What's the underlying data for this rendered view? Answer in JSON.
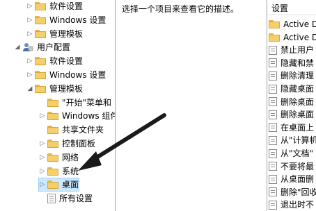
{
  "tree": {
    "items": [
      {
        "label": "软件设置",
        "level": 2,
        "type": "folder",
        "expand": "▷"
      },
      {
        "label": "Windows 设置",
        "level": 2,
        "type": "folder",
        "expand": "▷"
      },
      {
        "label": "管理模板",
        "level": 2,
        "type": "folder",
        "expand": "▷"
      },
      {
        "label": "用户配置",
        "level": 1,
        "type": "user",
        "expand": "◢"
      },
      {
        "label": "软件设置",
        "level": 2,
        "type": "folder",
        "expand": "▷"
      },
      {
        "label": "Windows 设置",
        "level": 2,
        "type": "folder",
        "expand": "▷"
      },
      {
        "label": "管理模板",
        "level": 2,
        "type": "folder",
        "expand": "◢"
      },
      {
        "label": "\"开始\"菜单和",
        "level": 3,
        "type": "folder",
        "expand": ""
      },
      {
        "label": "Windows 组件",
        "level": 3,
        "type": "folder",
        "expand": "▷"
      },
      {
        "label": "共享文件夹",
        "level": 3,
        "type": "folder",
        "expand": ""
      },
      {
        "label": "控制面板",
        "level": 3,
        "type": "folder",
        "expand": "▷"
      },
      {
        "label": "网络",
        "level": 3,
        "type": "folder",
        "expand": "▷"
      },
      {
        "label": "系统",
        "level": 3,
        "type": "folder",
        "expand": "▷"
      },
      {
        "label": "桌面",
        "level": 3,
        "type": "folder",
        "expand": "▷",
        "selected": true
      },
      {
        "label": "所有设置",
        "level": 3,
        "type": "doc",
        "expand": ""
      }
    ]
  },
  "description": {
    "text": "选择一个项目来查看它的描述。"
  },
  "settings_list": {
    "header": "设置",
    "items": [
      {
        "label": "Active De",
        "type": "folder"
      },
      {
        "label": "Active Di",
        "type": "folder"
      },
      {
        "label": "禁止用户",
        "type": "policy"
      },
      {
        "label": "隐藏和禁",
        "type": "policy"
      },
      {
        "label": "删除清理",
        "type": "policy"
      },
      {
        "label": "隐藏桌面",
        "type": "policy"
      },
      {
        "label": "删除桌面",
        "type": "policy"
      },
      {
        "label": "删除桌面",
        "type": "policy"
      },
      {
        "label": "在桌面上",
        "type": "policy"
      },
      {
        "label": "从\"计算机",
        "type": "policy"
      },
      {
        "label": "从\"文档\"",
        "type": "policy"
      },
      {
        "label": "不要将最",
        "type": "policy"
      },
      {
        "label": "从桌面删",
        "type": "policy"
      },
      {
        "label": "删除\"回收",
        "type": "policy"
      },
      {
        "label": "退出时不",
        "type": "policy"
      }
    ]
  },
  "colors": {
    "selection": "#cce8ff",
    "folder": "#f5cf6b",
    "arrow": "#1a1a1a"
  }
}
